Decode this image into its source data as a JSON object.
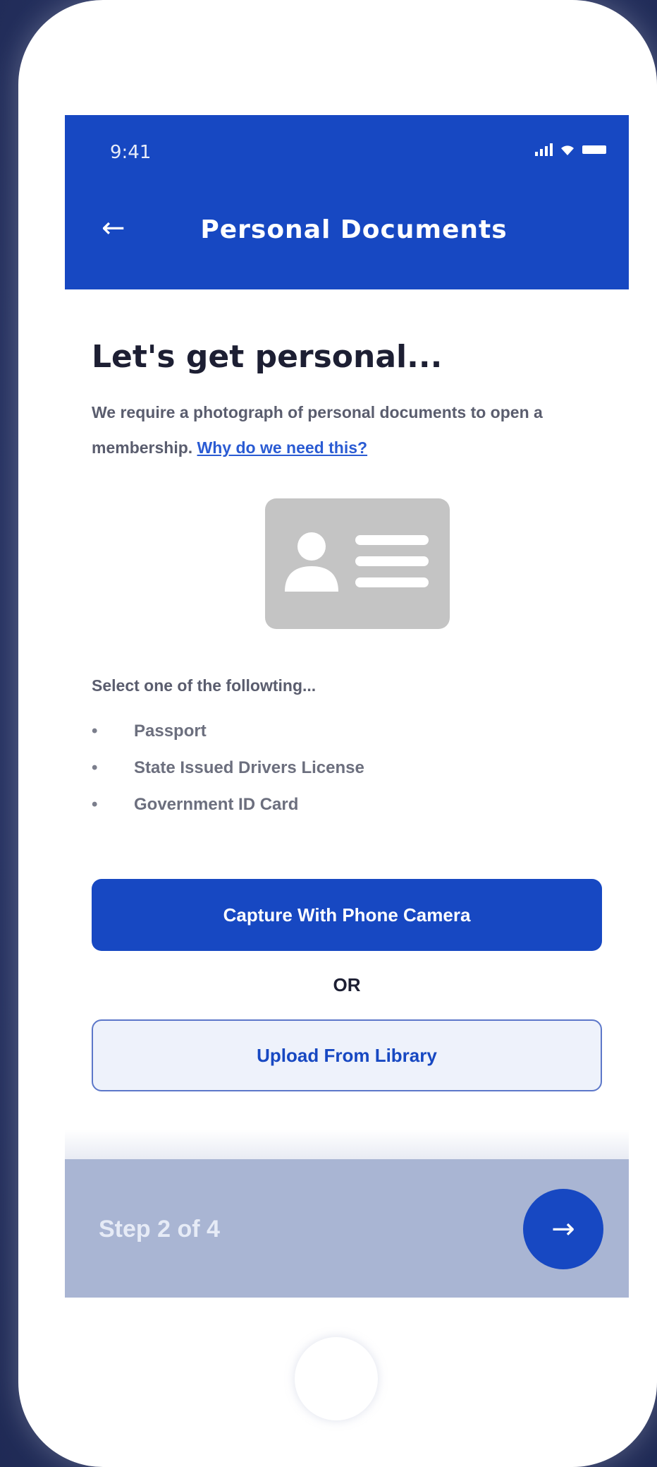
{
  "status_bar": {
    "time": "9:41",
    "icons": [
      "signal-icon",
      "wifi-icon",
      "battery-icon"
    ]
  },
  "header": {
    "back_icon": "←",
    "title": "Personal Documents"
  },
  "main": {
    "heading": "Let's get personal...",
    "intro_text": "We require a photograph of personal documents to open a membership. ",
    "why_link": "Why do we need this?",
    "select_label": "Select one of the followting...",
    "documents": [
      "Passport",
      "State Issued Drivers License",
      "Government ID Card"
    ]
  },
  "actions": {
    "capture_label": "Capture With Phone Camera",
    "or_label": "OR",
    "upload_label": "Upload From Library"
  },
  "footer": {
    "step_label": "Step 2 of 4",
    "next_icon": "→"
  },
  "colors": {
    "primary": "#1748c2",
    "footer_bg": "#a9b5d3",
    "id_card_bg": "#c4c4c4",
    "link": "#2a5bd3"
  }
}
